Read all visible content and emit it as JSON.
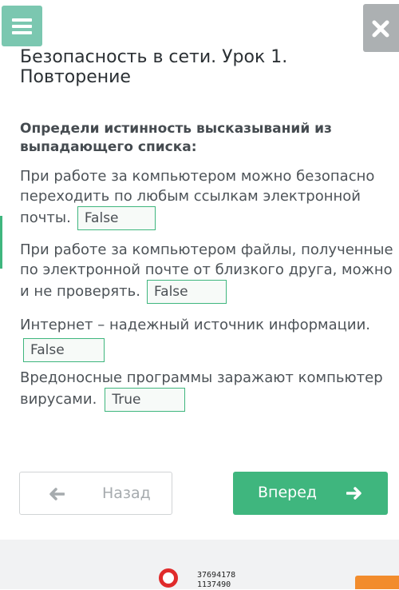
{
  "header": {
    "menu_icon": "hamburger-menu-icon",
    "close_icon": "close-x-icon",
    "colors": {
      "menu_bg": "#7bc7b0",
      "close_bg": "#acb0b2"
    }
  },
  "title": "Безопасность в сети. Урок 1. Повторение",
  "question": "Определи истинность высказываний из выпадающего списка:",
  "items": [
    {
      "text": "При работе за компьютером можно безопасно переходить по любым ссылкам электронной почты.",
      "answer": "False"
    },
    {
      "text": "При работе за компьютером файлы, полученные по электронной почте от близкого друга, можно и не проверять.",
      "answer": "False"
    },
    {
      "text": "Интернет – надежный источник информации.",
      "answer": "False"
    },
    {
      "text": "Вредоносные программы заражают компьютер вирусами.",
      "answer": "True"
    }
  ],
  "nav": {
    "back_label": "Назад",
    "next_label": "Вперед",
    "back_icon": "arrow-left-icon",
    "next_icon": "arrow-right-icon",
    "accent": "#3fb67e"
  },
  "ad": {
    "numbers": [
      "37694178",
      "1137490"
    ]
  }
}
